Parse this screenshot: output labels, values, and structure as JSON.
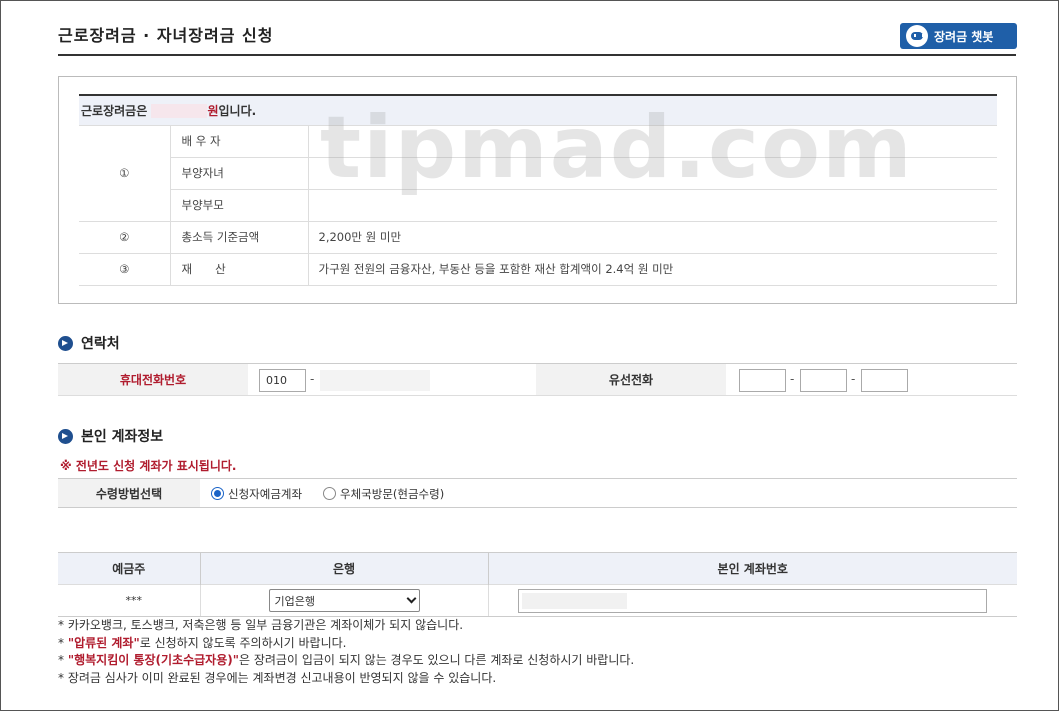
{
  "header": {
    "title": "근로장려금 · 자녀장려금 신청",
    "chatbot_label": "장려금 챗봇"
  },
  "summary": {
    "prefix": "근로장려금은",
    "suffix_won": "원",
    "suffix_rest": "입니다.",
    "rows": [
      {
        "num": "①",
        "label": "배 우 자",
        "value": ""
      },
      {
        "num": "",
        "label": "부양자녀",
        "value": ""
      },
      {
        "num": "",
        "label": "부양부모",
        "value": ""
      },
      {
        "num": "②",
        "label": "총소득 기준금액",
        "value": "2,200만 원 미만"
      },
      {
        "num": "③",
        "label": "재　　산",
        "value": "가구원 전원의 금융자산, 부동산 등을 포함한 재산 합계액이 2.4억 원 미만"
      }
    ]
  },
  "watermark": "tipmad.com",
  "contact": {
    "section_title": "연락처",
    "mobile_label": "휴대전화번호",
    "mobile_prefix": "010",
    "landline_label": "유선전화",
    "dash": "-"
  },
  "account": {
    "section_title": "본인 계좌정보",
    "notice": "※ 전년도 신청 계좌가 표시됩니다.",
    "method_label": "수령방법선택",
    "method_options": [
      "신청자예금계좌",
      "우체국방문(현금수령)"
    ],
    "method_selected": 0,
    "table_headers": [
      "예금주",
      "은행",
      "본인 계좌번호"
    ],
    "holder_masked": "***",
    "bank_selected": "기업은행"
  },
  "notes": {
    "n1": "* 카카오뱅크, 토스뱅크, 저축은행 등 일부 금융기관은 계좌이체가 되지 않습니다.",
    "n2_star": "* ",
    "n2_red": "\"압류된 계좌\"",
    "n2_rest": "로 신청하지 않도록 주의하시기 바랍니다.",
    "n3_star": "* ",
    "n3_red": "\"행복지킴이 통장(기초수급자용)\"",
    "n3_rest": "은 장려금이 입금이 되지 않는 경우도 있으니 다른 계좌로 신청하시기 바랍니다.",
    "n4": "* 장려금 심사가 이미 완료된 경우에는 계좌변경 신고내용이 반영되지 않을 수 있습니다."
  },
  "colors": {
    "accent_blue": "#1f5fa8",
    "alert_red": "#b01c2e"
  }
}
